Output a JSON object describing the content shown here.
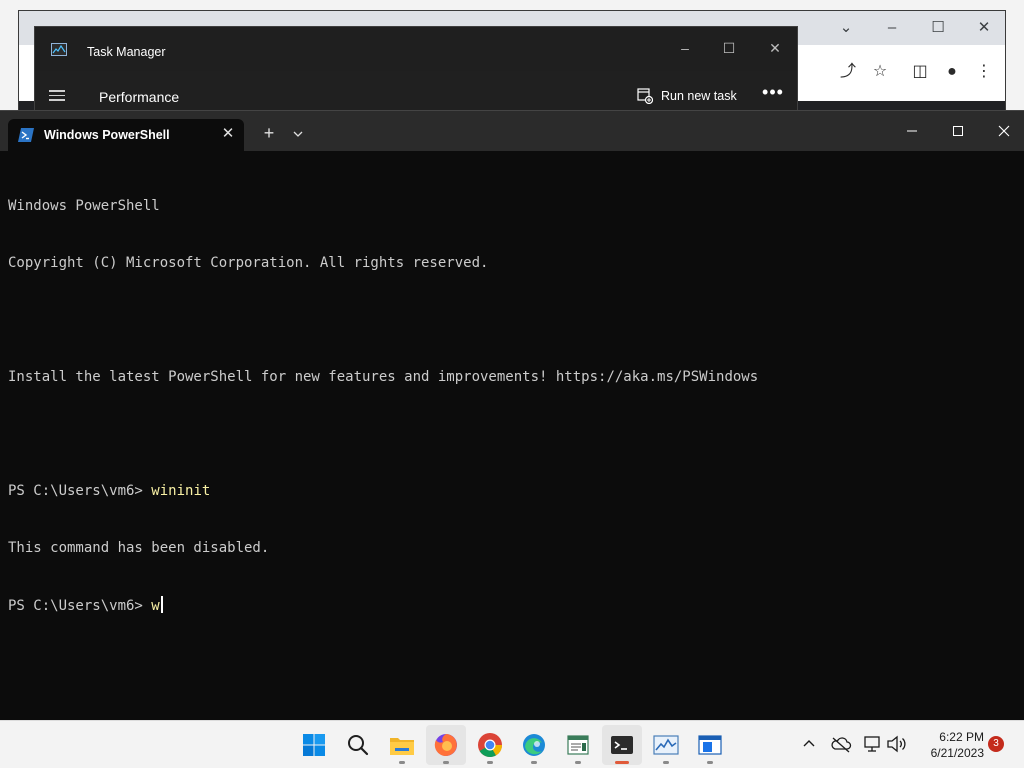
{
  "taskmanager": {
    "title": "Task Manager",
    "page_title": "Performance",
    "run_new_task_label": "Run new task",
    "more_label": "•••"
  },
  "terminal": {
    "tab_title": "Windows PowerShell",
    "lines": [
      {
        "text": "Windows PowerShell"
      },
      {
        "text": "Copyright (C) Microsoft Corporation. All rights reserved."
      },
      {
        "text": ""
      },
      {
        "text": "Install the latest PowerShell for new features and improvements! https://aka.ms/PSWindows"
      },
      {
        "text": ""
      },
      {
        "prompt": "PS C:\\Users\\vm6> ",
        "command": "wininit"
      },
      {
        "text": "This command has been disabled."
      },
      {
        "prompt": "PS C:\\Users\\vm6> ",
        "command": "w"
      }
    ]
  },
  "taskbar": {
    "apps": [
      {
        "name": "start",
        "icon": "windows-logo-icon"
      },
      {
        "name": "search",
        "icon": "search-icon"
      },
      {
        "name": "file-explorer",
        "icon": "folder-icon"
      },
      {
        "name": "firefox",
        "icon": "firefox-icon"
      },
      {
        "name": "chrome",
        "icon": "chrome-icon"
      },
      {
        "name": "edge",
        "icon": "edge-icon"
      },
      {
        "name": "notepad",
        "icon": "notepad-icon"
      },
      {
        "name": "terminal",
        "icon": "terminal-icon"
      },
      {
        "name": "task-manager",
        "icon": "task-manager-icon"
      },
      {
        "name": "vscode",
        "icon": "editor-icon"
      }
    ],
    "clock_time": "6:22 PM",
    "clock_date": "6/21/2023",
    "notification_count": "3"
  },
  "colors": {
    "terminal_bg": "#0c0c0c",
    "terminal_text": "#cccccc",
    "command_text": "#f9f1a5",
    "taskbar_bg": "#f3f3f3",
    "accent": "#0078d4"
  }
}
